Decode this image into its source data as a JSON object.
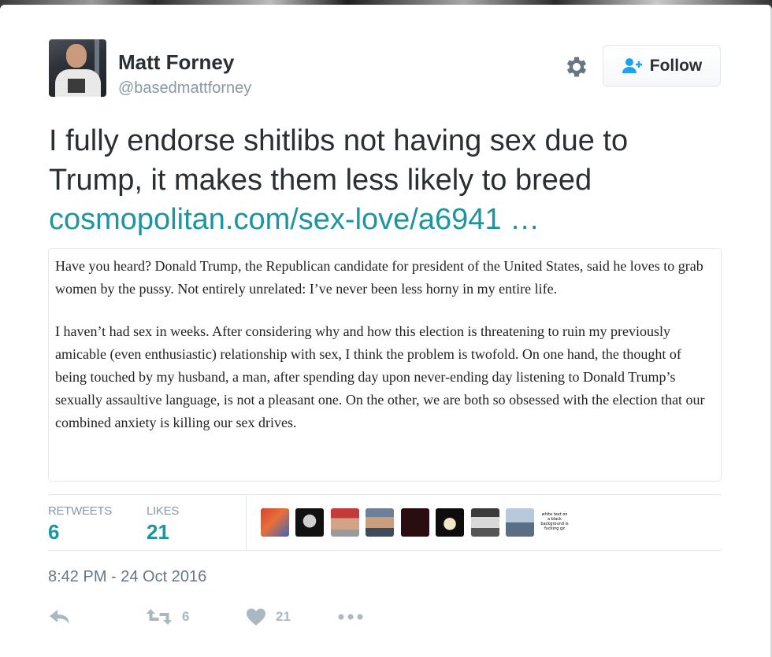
{
  "author": {
    "name": "Matt Forney",
    "handle": "@basedmattforney"
  },
  "follow_button": {
    "label": "Follow"
  },
  "tweet": {
    "text": "I fully endorse shitlibs not having sex due to Trump, it makes them less likely to breed",
    "link": "cosmopolitan.com/sex-love/a6941 …"
  },
  "quote": {
    "paragraphs": [
      "Have you heard? Donald Trump, the Republican candidate for president of the United States, said he loves to grab women by the pussy. Not entirely unrelated: I’ve never been less horny in my entire life.",
      "I haven’t had sex in weeks. After considering why and how this election is threatening to ruin my previously amicable (even enthusiastic) relationship with sex, I think the problem is twofold. On one hand, the thought of being touched by my husband, a man, after spending day upon never-ending day listening to Donald Trump’s sexually assaultive language, is not a pleasant one. On the other, we are both so obsessed with the election that our combined anxiety is killing our sex drives."
    ]
  },
  "stats": {
    "retweets_label": "RETWEETS",
    "retweets_value": "6",
    "likes_label": "LIKES",
    "likes_value": "21"
  },
  "liker_avatar_text": "white text on a black background is fucking gz",
  "timestamp": "8:42 PM - 24 Oct 2016",
  "actions": {
    "retweet_count": "6",
    "like_count": "21"
  },
  "colors": {
    "link": "#1b95a0",
    "text": "#292f33",
    "muted": "#8899a6",
    "follow_icon": "#1da1f2"
  },
  "icons": [
    "gear-icon",
    "follow-person-icon",
    "reply-icon",
    "retweet-icon",
    "heart-icon",
    "more-icon"
  ]
}
